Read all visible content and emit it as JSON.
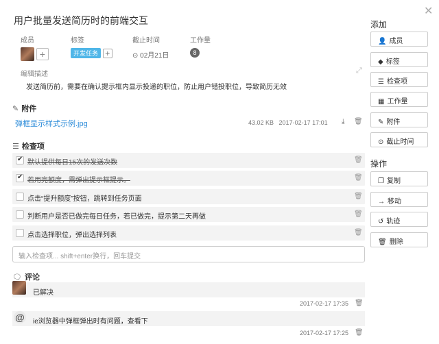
{
  "title": "用户批量发送简历时的前端交互",
  "meta": {
    "member_label": "成员",
    "tag_label": "标签",
    "tag_value": "开发任务",
    "deadline_label": "截止时间",
    "deadline_value": "02月21日",
    "workload_label": "工作量",
    "workload_value": "8"
  },
  "description": {
    "label": "编辑描述",
    "text": "发送简历前，需要在确认提示框内显示投递的职位，防止用户错投职位，导致简历无效"
  },
  "attachments": {
    "heading": "附件",
    "items": [
      {
        "name": "弹框显示样式示例.jpg",
        "size": "43.02 KB",
        "date": "2017-02-17 17:01"
      }
    ]
  },
  "checklist": {
    "heading": "检查项",
    "items": [
      {
        "text": "默认提供每日15次的发送次数",
        "done": true
      },
      {
        "text": "若用完额度，需弹出提示框提示。",
        "done": true
      },
      {
        "text": "点击“提升额度”按钮，跳转到任务页面",
        "done": false
      },
      {
        "text": "判断用户是否已做完每日任务，若已做完，提示第二天再做",
        "done": false
      },
      {
        "text": "点击选择职位，弹出选择列表",
        "done": false
      }
    ],
    "input_placeholder": "输入检查项... shift+enter换行，回车提交"
  },
  "comments": {
    "heading": "评论",
    "items": [
      {
        "text": "已解决",
        "time": "2017-02-17 17:35"
      },
      {
        "text": "ie浏览器中弹框弹出时有问题，查看下",
        "time": "2017-02-17 17:25"
      }
    ]
  },
  "sidebar": {
    "add_heading": "添加",
    "add_buttons": [
      {
        "label": "成员",
        "icon": "add-user-icon"
      },
      {
        "label": "标签",
        "icon": "tag-icon"
      },
      {
        "label": "检查项",
        "icon": "list-icon"
      },
      {
        "label": "工作量",
        "icon": "grid-icon"
      },
      {
        "label": "附件",
        "icon": "paperclip-icon"
      },
      {
        "label": "截止时间",
        "icon": "clock-icon"
      }
    ],
    "action_heading": "操作",
    "action_buttons": [
      {
        "label": "复制",
        "icon": "copy-icon"
      },
      {
        "label": "移动",
        "icon": "arrow-right-icon"
      },
      {
        "label": "轨迹",
        "icon": "history-icon"
      },
      {
        "label": "删除",
        "icon": "trash-icon"
      }
    ]
  }
}
